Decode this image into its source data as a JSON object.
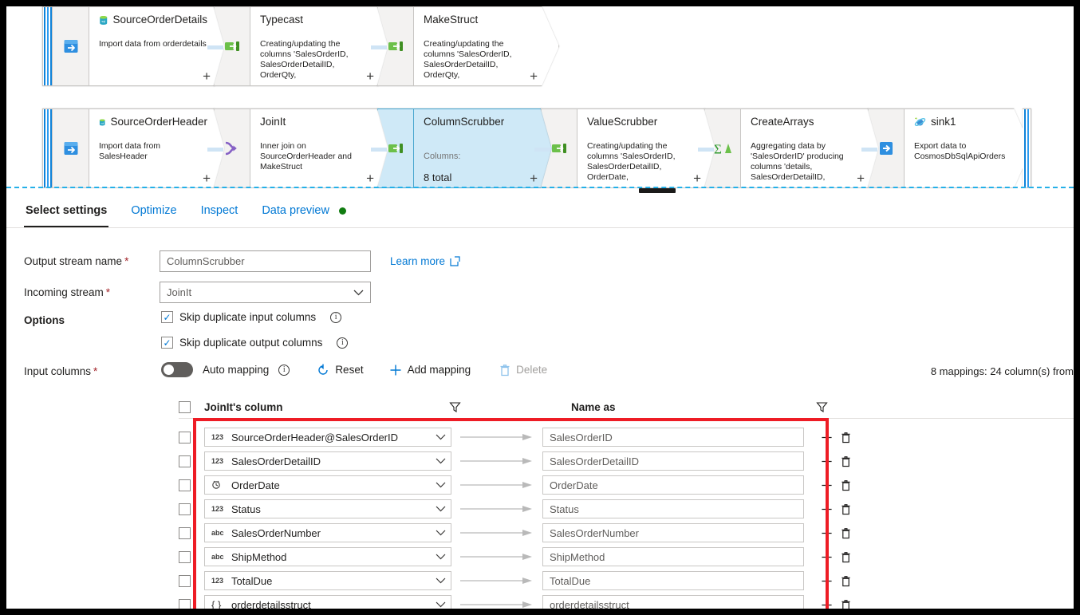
{
  "canvas": {
    "rows": [
      {
        "nodes": [
          {
            "id": "source-order-details",
            "title": "SourceOrderDetails",
            "icon": "sql-database-icon",
            "lead_icon": "source-import-icon",
            "desc": "Import data from orderdetails",
            "kind": "source",
            "selected": false
          },
          {
            "id": "typecast",
            "title": "Typecast",
            "icon": "",
            "lead_icon": "derived-column-icon",
            "desc": "Creating/updating the columns 'SalesOrderID,\nSalesOrderDetailID, OrderQty,\nProductID, UnitPrice,",
            "kind": "transform",
            "selected": false
          },
          {
            "id": "make-struct",
            "title": "MakeStruct",
            "icon": "",
            "lead_icon": "derived-column-icon",
            "desc": "Creating/updating the columns 'SalesOrderID,\nSalesOrderDetailID, OrderQty,\nProductID, UnitPrice,",
            "kind": "transform",
            "selected": false
          }
        ]
      },
      {
        "nodes": [
          {
            "id": "source-order-header",
            "title": "SourceOrderHeader",
            "icon": "sql-database-icon",
            "lead_icon": "source-import-icon",
            "desc": "Import data from SalesHeader",
            "kind": "source",
            "selected": false
          },
          {
            "id": "joinit",
            "title": "JoinIt",
            "icon": "",
            "lead_icon": "join-icon",
            "desc": "Inner join on\nSourceOrderHeader and\nMakeStruct",
            "kind": "transform",
            "selected": false
          },
          {
            "id": "column-scrubber",
            "title": "ColumnScrubber",
            "icon": "",
            "lead_icon": "select-icon",
            "desc_label": "Columns:",
            "desc_value": "8 total",
            "kind": "select",
            "selected": true
          },
          {
            "id": "value-scrubber",
            "title": "ValueScrubber",
            "icon": "",
            "lead_icon": "derived-column-icon",
            "desc": "Creating/updating the columns 'SalesOrderID,\nSalesOrderDetailID, OrderDate,\nStatus, SalesOrderNumber,",
            "kind": "transform",
            "selected": false
          },
          {
            "id": "create-arrays",
            "title": "CreateArrays",
            "icon": "",
            "lead_icon": "aggregate-icon",
            "desc": "Aggregating data by\n'SalesOrderID' producing\ncolumns 'details,\nSalesOrderDetailID, OrderDate,",
            "kind": "transform",
            "selected": false
          },
          {
            "id": "sink1",
            "title": "sink1",
            "icon": "cosmos-db-icon",
            "lead_icon": "sink-export-icon",
            "desc": "Export data to\nCosmosDbSqlApiOrders",
            "kind": "sink",
            "selected": false
          }
        ]
      }
    ],
    "add_label": "+"
  },
  "tabs": [
    {
      "label": "Select settings",
      "active": true,
      "dot": false
    },
    {
      "label": "Optimize",
      "active": false,
      "dot": false
    },
    {
      "label": "Inspect",
      "active": false,
      "dot": false
    },
    {
      "label": "Data preview",
      "active": false,
      "dot": true
    }
  ],
  "settings": {
    "output_stream_label": "Output stream name",
    "output_stream_value": "ColumnScrubber",
    "incoming_stream_label": "Incoming stream",
    "incoming_stream_value": "JoinIt",
    "learn_more": "Learn more",
    "options_label": "Options",
    "skip_dup_input": "Skip duplicate input columns",
    "skip_dup_input_checked": true,
    "skip_dup_output": "Skip duplicate output columns",
    "skip_dup_output_checked": true,
    "input_columns_label": "Input columns",
    "auto_mapping_label": "Auto mapping",
    "auto_mapping_on": false,
    "reset_label": "Reset",
    "add_mapping_label": "Add mapping",
    "delete_label": "Delete",
    "mapping_summary": "8 mappings: 24 column(s) from"
  },
  "table": {
    "col1_header": "JoinIt's column",
    "col2_header": "Name as",
    "rows": [
      {
        "type": "123",
        "source": "SourceOrderHeader@SalesOrderID",
        "name_as": "SalesOrderID"
      },
      {
        "type": "123",
        "source": "SalesOrderDetailID",
        "name_as": "SalesOrderDetailID"
      },
      {
        "type": "date",
        "source": "OrderDate",
        "name_as": "OrderDate"
      },
      {
        "type": "123",
        "source": "Status",
        "name_as": "Status"
      },
      {
        "type": "abc",
        "source": "SalesOrderNumber",
        "name_as": "SalesOrderNumber"
      },
      {
        "type": "abc",
        "source": "ShipMethod",
        "name_as": "ShipMethod"
      },
      {
        "type": "123",
        "source": "TotalDue",
        "name_as": "TotalDue"
      },
      {
        "type": "{}",
        "source": "orderdetailsstruct",
        "name_as": "orderdetailsstruct"
      }
    ]
  },
  "colors": {
    "accent": "#0078d4",
    "highlight_box": "#ee1c25",
    "selected_node": "#cfe9f7",
    "status_dot": "#107c10"
  }
}
